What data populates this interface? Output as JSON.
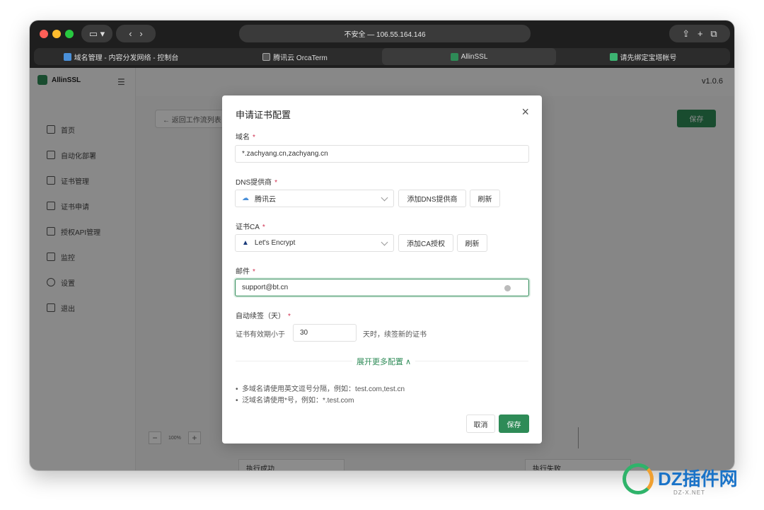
{
  "browser": {
    "url_text": "不安全 — 106.55.164.146",
    "tabs": [
      {
        "label": "域名管理 - 内容分发网络 - 控制台"
      },
      {
        "label": "腾讯云 OrcaTerm"
      },
      {
        "label": "AllinSSL"
      },
      {
        "label": "请先绑定宝塔帐号"
      }
    ]
  },
  "app": {
    "name": "AllinSSL",
    "version": "v1.0.6",
    "menu": [
      {
        "label": "首页",
        "icon": "home-icon"
      },
      {
        "label": "自动化部署",
        "icon": "flow-icon"
      },
      {
        "label": "证书管理",
        "icon": "certificate-icon"
      },
      {
        "label": "证书申请",
        "icon": "plus-square-icon"
      },
      {
        "label": "授权API管理",
        "icon": "api-icon"
      },
      {
        "label": "监控",
        "icon": "monitor-icon"
      },
      {
        "label": "设置",
        "icon": "gear-icon"
      },
      {
        "label": "退出",
        "icon": "logout-icon"
      }
    ],
    "back_label": "← 返回工作流列表",
    "save_label": "保存",
    "zoom_level": "100%",
    "canvas_nodes": [
      "执行成功",
      "执行失败"
    ]
  },
  "modal": {
    "title": "申请证书配置",
    "domain": {
      "label": "域名",
      "value": "*.zachyang.cn,zachyang.cn"
    },
    "dns": {
      "label": "DNS提供商",
      "value": "腾讯云",
      "add_label": "添加DNS提供商",
      "refresh_label": "刷新"
    },
    "ca": {
      "label": "证书CA",
      "value": "Let's Encrypt",
      "add_label": "添加CA授权",
      "refresh_label": "刷新"
    },
    "email": {
      "label": "邮件",
      "value": "support@bt.cn"
    },
    "renew": {
      "label": "自动续签（天）",
      "prefix": "证书有效期小于",
      "value": "30",
      "suffix": "天时，续签新的证书"
    },
    "expand_label": "展开更多配置",
    "tips": [
      "多域名请使用英文逗号分隔，例如：test.com,test.cn",
      "泛域名请使用*号，例如：*.test.com"
    ],
    "cancel_label": "取消",
    "save_label": "保存"
  },
  "watermark": {
    "text": "DZ插件网",
    "sub": "DZ-X.NET"
  }
}
